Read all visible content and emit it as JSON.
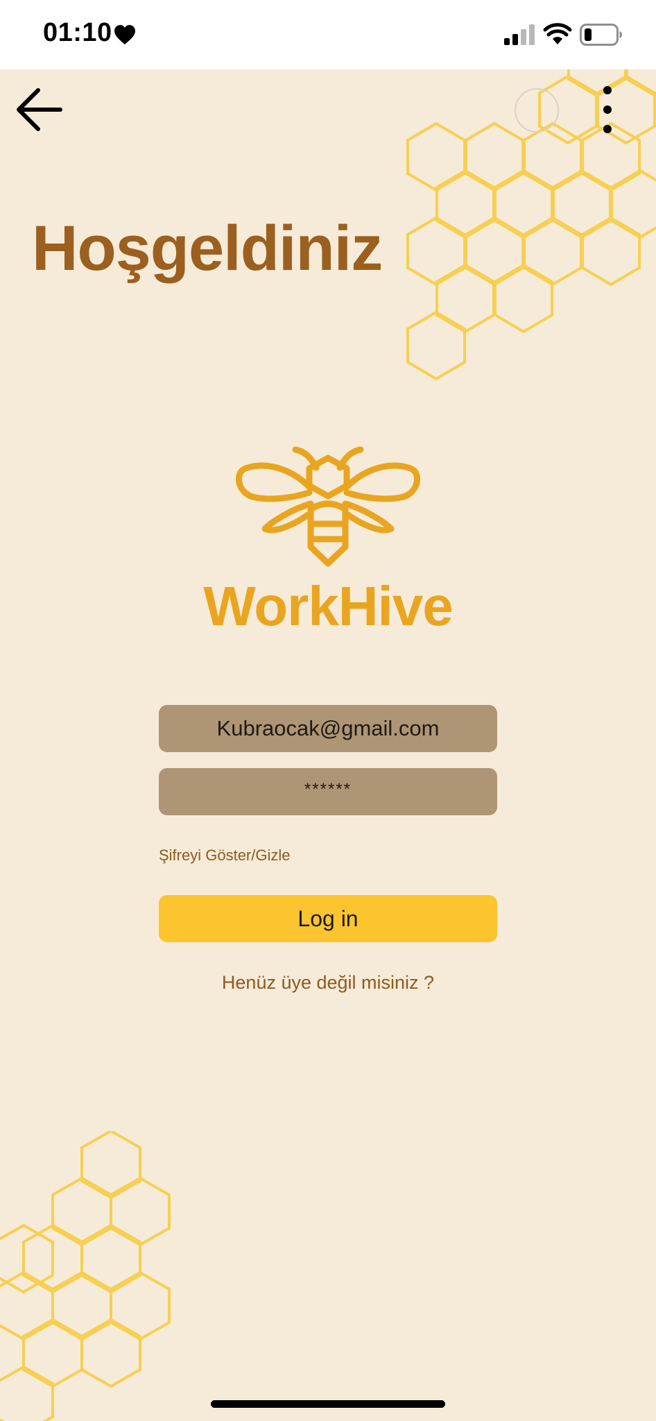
{
  "status_bar": {
    "time": "01:10",
    "icons": [
      "heart-icon",
      "signal-icon",
      "wifi-icon",
      "battery-icon"
    ]
  },
  "header": {
    "back_icon": "arrow-left-icon",
    "menu_icon": "more-vertical-icon"
  },
  "welcome": {
    "title": "Hoşgeldiniz"
  },
  "brand": {
    "name": "WorkHive",
    "logo_icon": "bee-icon",
    "color": "#e9a520"
  },
  "login_form": {
    "email_value": "Kubraocak@gmail.com",
    "password_value": "******",
    "toggle_password_label": "Şifreyi Göster/Gizle",
    "login_label": "Log in",
    "signup_prompt": "Henüz üye değil misiniz ?"
  },
  "colors": {
    "background": "#f6ebd8",
    "title": "#9b5f1f",
    "field": "#ae9576",
    "button": "#fcc42e",
    "link": "#8d5a1e",
    "honeycomb": "#f7cf52"
  }
}
